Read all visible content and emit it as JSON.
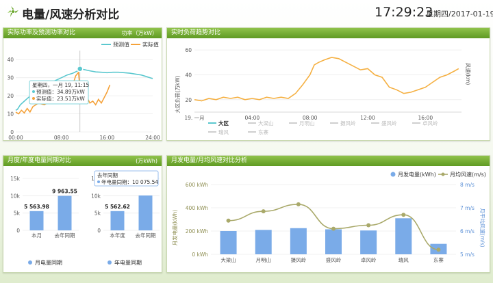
{
  "header": {
    "title": "电量/风速分析对比",
    "time": "17:29:23",
    "date": "星期四/2017-01-19"
  },
  "colors": {
    "accent_green": "#6aa52c",
    "predict": "#5bc8cf",
    "actual": "#f5a23a",
    "load_line": "#f5b042",
    "bar_blue": "#7aabe8",
    "wind_line": "#a9a96a"
  },
  "panel1": {
    "title": "实际功率及预测功率对比",
    "unit": "功率（万kW）",
    "legend": {
      "predict": "预测值",
      "actual": "实际值"
    },
    "yticks": [
      "0",
      "10",
      "20",
      "30",
      "40"
    ],
    "xticks": [
      "00:00",
      "08:00",
      "16:00",
      "24:00"
    ],
    "tooltip": {
      "title": "星期四，一月 19, 11:15",
      "predict": "预测值：34.89万kW",
      "actual": "实际值：23.51万kW"
    }
  },
  "panel2": {
    "title": "实时负荷趋势对比",
    "ylabel": "大区负荷(万kW)",
    "ylabel_right": "风速(km)",
    "yticks": [
      "20",
      "40",
      "60"
    ],
    "xticks": [
      "19. 一月",
      "04:00",
      "08:00",
      "12:00",
      "16:00"
    ],
    "legend": [
      "大区",
      "大梁山",
      "月明山",
      "摄风岭",
      "盛风岭",
      "卓风岭",
      "瑞风",
      "东寨"
    ]
  },
  "panel3": {
    "title": "月度/年度电量同期对比",
    "unit": "(万kWh)",
    "yticks": [
      "0",
      "5k",
      "10k",
      "15k"
    ],
    "left": {
      "categories": [
        "本月",
        "去年同期"
      ],
      "labels": [
        "5 563.98",
        "9 963.55"
      ],
      "legend": "月电量同期"
    },
    "right": {
      "categories": [
        "本年度",
        "去年同期"
      ],
      "labels": [
        "5 562.62"
      ],
      "legend": "年电量同期",
      "tooltip": {
        "title": "去年同期",
        "text": "年电量同期：10 075.54"
      }
    }
  },
  "panel4": {
    "title": "月发电量/月均风速对比分析",
    "legend": {
      "bars": "月发电量(kWh)",
      "line": "月均风速(m/s)"
    },
    "ylabel_left": "月发电量(kWh)",
    "ylabel_right": "月平均风速(m/s)",
    "yticks_left": [
      "0 kWh",
      "200 kWh",
      "400 kWh",
      "600 kWh"
    ],
    "yticks_right": [
      "5 m/s",
      "6 m/s",
      "7 m/s",
      "8 m/s"
    ]
  },
  "chart_data": [
    {
      "type": "line",
      "title": "实际功率及预测功率对比",
      "ylabel": "功率（万kW）",
      "ylim": [
        0,
        45
      ],
      "xlim_hours": [
        0,
        24
      ],
      "series": [
        {
          "name": "预测值",
          "x": [
            0,
            0.3,
            0.8,
            1.5,
            2.2,
            3,
            4,
            5,
            6,
            7,
            8,
            9,
            10,
            11,
            11.25,
            12,
            13,
            14,
            15,
            16,
            17,
            18,
            19,
            20,
            21,
            22,
            23,
            24
          ],
          "y": [
            12,
            12.5,
            15,
            17,
            19,
            21,
            23,
            25,
            27,
            28.5,
            30,
            31.5,
            32.5,
            34,
            34.89,
            34.5,
            33.8,
            33.2,
            33,
            32.8,
            33,
            33,
            32.8,
            32.5,
            32,
            31.5,
            30.5,
            29.5
          ]
        },
        {
          "name": "实际值",
          "x": [
            0,
            0.5,
            1,
            1.5,
            2,
            2.5,
            3,
            4,
            5,
            6,
            7,
            8,
            9,
            10,
            10.5,
            11,
            11.25,
            11.6,
            12,
            12.5,
            13,
            13.5,
            14,
            14.5,
            15,
            15.5,
            16,
            16.5
          ],
          "y": [
            11,
            10,
            12,
            10.5,
            13,
            11,
            14,
            16,
            15,
            17,
            18,
            20,
            23,
            26,
            31,
            33,
            23.51,
            20,
            22,
            19,
            16,
            17,
            15,
            18,
            16,
            19,
            22,
            26
          ]
        }
      ]
    },
    {
      "type": "line",
      "title": "实时负荷趋势对比",
      "ylabel": "大区负荷(万kW)",
      "ylim": [
        10,
        65
      ],
      "xlim_hours": [
        0,
        18.5
      ],
      "series": [
        {
          "name": "大区",
          "x": [
            0,
            0.5,
            1,
            1.5,
            2,
            2.5,
            3,
            3.5,
            4,
            4.5,
            5,
            5.5,
            6,
            6.5,
            7,
            7.5,
            8,
            8.3,
            8.6,
            9,
            9.5,
            10,
            10.5,
            11,
            11.5,
            12,
            12.5,
            13,
            13.5,
            14,
            14.5,
            15,
            15.5,
            16,
            16.5,
            17,
            17.5,
            18,
            18.3
          ],
          "y": [
            20,
            19,
            21,
            20,
            22,
            21,
            22,
            20,
            21,
            20,
            22,
            21,
            22,
            21,
            25,
            32,
            40,
            48,
            50,
            52,
            54,
            53,
            50,
            47,
            44,
            45,
            40,
            38,
            30,
            28,
            25,
            26,
            28,
            30,
            34,
            38,
            40,
            43,
            45
          ]
        }
      ]
    },
    {
      "type": "bar",
      "title": "月度电量同期对比",
      "ylabel": "(万kWh)",
      "ylim": [
        0,
        15000
      ],
      "categories": [
        "本月",
        "去年同期"
      ],
      "series": [
        {
          "name": "月电量同期",
          "values": [
            5563.98,
            9963.55
          ]
        }
      ]
    },
    {
      "type": "bar",
      "title": "年度电量同期对比",
      "ylabel": "(万kWh)",
      "ylim": [
        0,
        15000
      ],
      "categories": [
        "本年度",
        "去年同期"
      ],
      "series": [
        {
          "name": "年电量同期",
          "values": [
            5562.62,
            10075.54
          ]
        }
      ]
    },
    {
      "type": "bar",
      "title": "月发电量/月均风速对比分析",
      "categories": [
        "大梁山",
        "月明山",
        "摄风岭",
        "盛风岭",
        "卓风岭",
        "瑞风",
        "东寨"
      ],
      "ylim_left": [
        0,
        600
      ],
      "ylim_right": [
        5,
        8
      ],
      "series": [
        {
          "name": "月发电量(kWh)",
          "values": [
            200,
            210,
            225,
            215,
            205,
            310,
            90
          ]
        },
        {
          "name": "月均风速(m/s)",
          "values": [
            6.45,
            6.85,
            7.15,
            6.1,
            6.25,
            6.7,
            5.2
          ]
        }
      ]
    }
  ]
}
